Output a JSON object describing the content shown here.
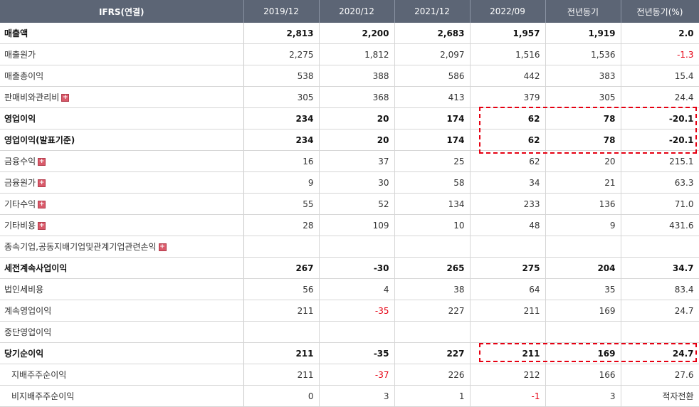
{
  "columns": [
    "IFRS(연결)",
    "2019/12",
    "2020/12",
    "2021/12",
    "2022/09",
    "전년동기",
    "전년동기(%)"
  ],
  "rows": [
    {
      "label": "매출액",
      "bold": true,
      "expand": false,
      "sub": false,
      "values": [
        "2,813",
        "2,200",
        "2,683",
        "1,957",
        "1,919",
        "2.0"
      ],
      "neg": [
        false,
        false,
        false,
        false,
        false,
        false
      ]
    },
    {
      "label": "매출원가",
      "bold": false,
      "expand": false,
      "sub": false,
      "values": [
        "2,275",
        "1,812",
        "2,097",
        "1,516",
        "1,536",
        "-1.3"
      ],
      "neg": [
        false,
        false,
        false,
        false,
        false,
        true
      ]
    },
    {
      "label": "매출총이익",
      "bold": false,
      "expand": false,
      "sub": false,
      "values": [
        "538",
        "388",
        "586",
        "442",
        "383",
        "15.4"
      ],
      "neg": [
        false,
        false,
        false,
        false,
        false,
        false
      ]
    },
    {
      "label": "판매비와관리비",
      "bold": false,
      "expand": true,
      "sub": false,
      "values": [
        "305",
        "368",
        "413",
        "379",
        "305",
        "24.4"
      ],
      "neg": [
        false,
        false,
        false,
        false,
        false,
        false
      ]
    },
    {
      "label": "영업이익",
      "bold": true,
      "expand": false,
      "sub": false,
      "sep": true,
      "values": [
        "234",
        "20",
        "174",
        "62",
        "78",
        "-20.1"
      ],
      "neg": [
        false,
        false,
        false,
        false,
        false,
        true
      ]
    },
    {
      "label": "영업이익(발표기준)",
      "bold": true,
      "expand": false,
      "sub": false,
      "values": [
        "234",
        "20",
        "174",
        "62",
        "78",
        "-20.1"
      ],
      "neg": [
        false,
        false,
        false,
        false,
        false,
        true
      ]
    },
    {
      "label": "금융수익",
      "bold": false,
      "expand": true,
      "sub": false,
      "values": [
        "16",
        "37",
        "25",
        "62",
        "20",
        "215.1"
      ],
      "neg": [
        false,
        false,
        false,
        false,
        false,
        false
      ]
    },
    {
      "label": "금융원가",
      "bold": false,
      "expand": true,
      "sub": false,
      "values": [
        "9",
        "30",
        "58",
        "34",
        "21",
        "63.3"
      ],
      "neg": [
        false,
        false,
        false,
        false,
        false,
        false
      ]
    },
    {
      "label": "기타수익",
      "bold": false,
      "expand": true,
      "sub": false,
      "values": [
        "55",
        "52",
        "134",
        "233",
        "136",
        "71.0"
      ],
      "neg": [
        false,
        false,
        false,
        false,
        false,
        false
      ]
    },
    {
      "label": "기타비용",
      "bold": false,
      "expand": true,
      "sub": false,
      "values": [
        "28",
        "109",
        "10",
        "48",
        "9",
        "431.6"
      ],
      "neg": [
        false,
        false,
        false,
        false,
        false,
        false
      ]
    },
    {
      "label": "종속기업,공동지배기업및관계기업관련손익",
      "bold": false,
      "expand": true,
      "sub": false,
      "values": [
        "",
        "",
        "",
        "",
        "",
        ""
      ],
      "neg": [
        false,
        false,
        false,
        false,
        false,
        false
      ]
    },
    {
      "label": "세전계속사업이익",
      "bold": true,
      "expand": false,
      "sub": false,
      "values": [
        "267",
        "-30",
        "265",
        "275",
        "204",
        "34.7"
      ],
      "neg": [
        false,
        true,
        false,
        false,
        false,
        false
      ]
    },
    {
      "label": "법인세비용",
      "bold": false,
      "expand": false,
      "sub": false,
      "values": [
        "56",
        "4",
        "38",
        "64",
        "35",
        "83.4"
      ],
      "neg": [
        false,
        false,
        false,
        false,
        false,
        false
      ]
    },
    {
      "label": "계속영업이익",
      "bold": false,
      "expand": false,
      "sub": false,
      "values": [
        "211",
        "-35",
        "227",
        "211",
        "169",
        "24.7"
      ],
      "neg": [
        false,
        true,
        false,
        false,
        false,
        false
      ]
    },
    {
      "label": "중단영업이익",
      "bold": false,
      "expand": false,
      "sub": false,
      "values": [
        "",
        "",
        "",
        "",
        "",
        ""
      ],
      "neg": [
        false,
        false,
        false,
        false,
        false,
        false
      ]
    },
    {
      "label": "당기순이익",
      "bold": true,
      "expand": false,
      "sub": false,
      "values": [
        "211",
        "-35",
        "227",
        "211",
        "169",
        "24.7"
      ],
      "neg": [
        false,
        true,
        false,
        false,
        false,
        false
      ]
    },
    {
      "label": "지배주주순이익",
      "bold": false,
      "expand": false,
      "sub": true,
      "values": [
        "211",
        "-37",
        "226",
        "212",
        "166",
        "27.6"
      ],
      "neg": [
        false,
        true,
        false,
        false,
        false,
        false
      ]
    },
    {
      "label": "비지배주주순이익",
      "bold": false,
      "expand": false,
      "sub": true,
      "values": [
        "0",
        "3",
        "1",
        "-1",
        "3",
        "적자전환"
      ],
      "neg": [
        false,
        false,
        false,
        true,
        false,
        false
      ]
    }
  ],
  "highlight_color": "#e60012",
  "plus_icon": "expand-plus-icon"
}
